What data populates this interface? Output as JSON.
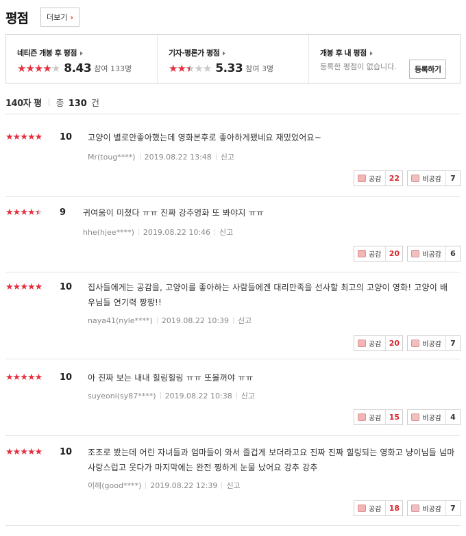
{
  "header": {
    "title": "평점",
    "more_label": "더보기"
  },
  "summary": {
    "netizen": {
      "title": "네티즌 개봉 후 평점",
      "score": "8.43",
      "count": "참여 133명",
      "stars": 4
    },
    "critic": {
      "title": "기자·평론가 평점",
      "score": "5.33",
      "count": "참여 3명",
      "stars": 2.5
    },
    "mine": {
      "title": "개봉 후 내 평점",
      "empty": "등록한 평점이 없습니다.",
      "button": "등록하기"
    }
  },
  "countbar": {
    "label": "140자 평",
    "total_prefix": "총",
    "total": "130",
    "total_suffix": "건"
  },
  "vote_labels": {
    "agree": "공감",
    "disagree": "비공감"
  },
  "report_label": "신고",
  "reviews": [
    {
      "stars": 5,
      "score": "10",
      "text": "고양이 별로안좋아했는데 영화본후로 좋아하게됐네요 재밌었어요~",
      "user": "Mr(toug****)",
      "date": "2019.08.22 13:48",
      "agree": "22",
      "disagree": "7"
    },
    {
      "stars": 4.5,
      "score": "9",
      "text": "귀여움이 미쳤다 ㅠㅠ 진짜 강추영화 또 봐야지 ㅠㅠ",
      "user": "hhe(hjee****)",
      "date": "2019.08.22 10:46",
      "agree": "20",
      "disagree": "6"
    },
    {
      "stars": 5,
      "score": "10",
      "text": "집사들에게는 공감을, 고양이를 좋아하는 사람들에겐 대리만족을 선사할 최고의 고양이 영화! 고양이 배우님들 연기력 짱짱!!",
      "user": "naya41(nyle****)",
      "date": "2019.08.22 10:39",
      "agree": "20",
      "disagree": "7"
    },
    {
      "stars": 5,
      "score": "10",
      "text": "아 진짜 보는 내내 힐링힐링 ㅠㅠ 또볼꺼야 ㅠㅠ",
      "user": "suyeoni(sy87****)",
      "date": "2019.08.22 10:38",
      "agree": "15",
      "disagree": "4"
    },
    {
      "stars": 5,
      "score": "10",
      "text": "조조로 봤는데 어린 자녀들과 엄마들이 와서 즐겁게 보더라고요 진짜 진짜 힐링되는 영화고 냥이님들 넘마 사랑스럽고 웃다가 마지막에는 완전 찡하게 눈물 났어요 강추 강추",
      "user": "이해(good****)",
      "date": "2019.08.22 12:39",
      "agree": "18",
      "disagree": "7"
    }
  ],
  "colors": {
    "accent": "#e62e3d",
    "star_off": "#c9c9c9"
  }
}
